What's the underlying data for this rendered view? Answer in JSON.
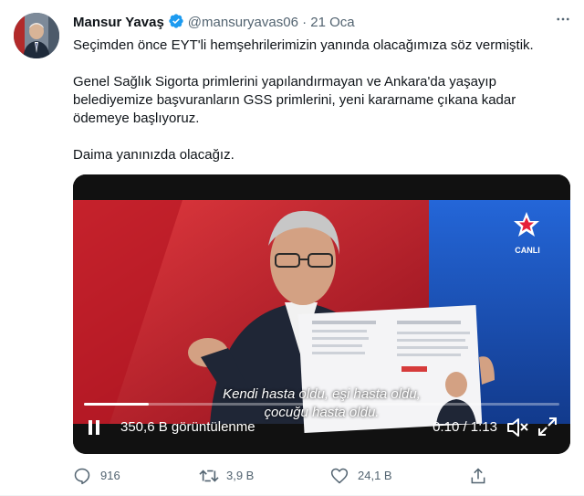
{
  "tweet": {
    "author_name": "Mansur Yavaş",
    "handle": "@mansuryavas06",
    "separator": "·",
    "date": "21 Oca",
    "more_icon": "more-horizontal-icon",
    "paragraphs": [
      "Seçimden önce EYT'li hemşehrilerimizin yanında olacağımıza söz vermiştik.",
      "Genel Sağlık Sigorta primlerini yapılandırmayan ve Ankara'da yaşayıp belediyemize başvuranların GSS primlerini, yeni kararname çıkana kadar ödemeye başlıyoruz.",
      "Daima yanınızda olacağız."
    ]
  },
  "video": {
    "subtitle_line1": "Kendi hasta oldu, eşi hasta oldu,",
    "subtitle_line2": "çocuğu hasta oldu.",
    "channel_label": "CANLI",
    "view_count": "350,6 B görüntülenme",
    "time": "0:10 / 1:13",
    "progress_fraction": 0.137,
    "colors": {
      "left_bg": "#c8202c",
      "right_bg": "#1b58c9"
    }
  },
  "actions": {
    "reply_count": "916",
    "retweet_count": "3,9 B",
    "like_count": "24,1 B",
    "share_icon": "share-icon"
  },
  "colors": {
    "verified_blue": "#1d9bf0",
    "secondary_text": "#536471"
  }
}
